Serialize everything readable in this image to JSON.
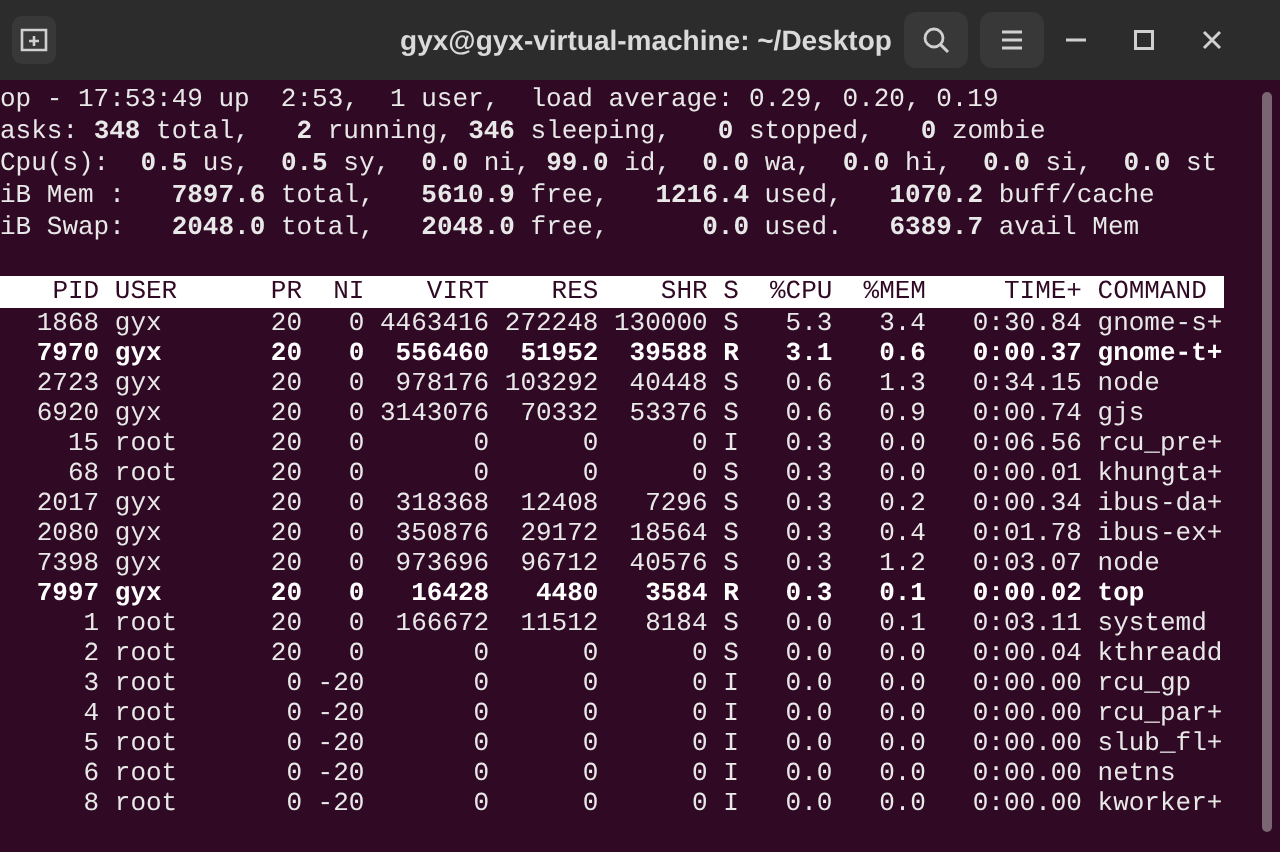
{
  "window": {
    "title": "gyx@gyx-virtual-machine: ~/Desktop"
  },
  "summary_lines": [
    "op - 17:53:49 up  2:53,  1 user,  load average: 0.29, 0.20, 0.19",
    "asks: **348** total,   **2** running, **346** sleeping,   **0** stopped,   **0** zombie",
    "Cpu(s):  **0.5** us,  **0.5** sy,  **0.0** ni, **99.0** id,  **0.0** wa,  **0.0** hi,  **0.0** si,  **0.0** st",
    "iB Mem :   **7897.6** total,   **5610.9** free,   **1216.4** used,   **1070.2** buff/cache",
    "iB Swap:   **2048.0** total,   **2048.0** free,      **0.0** used.   **6389.7** avail Mem"
  ],
  "table": {
    "columns": [
      "PID",
      "USER",
      "PR",
      "NI",
      "VIRT",
      "RES",
      "SHR",
      "S",
      "%CPU",
      "%MEM",
      "TIME+",
      "COMMAND"
    ],
    "rows": [
      {
        "emphasized": false,
        "cells": [
          "1868",
          "gyx",
          "20",
          "0",
          "4463416",
          "272248",
          "130000",
          "S",
          "5.3",
          "3.4",
          "0:30.84",
          "gnome-s+"
        ]
      },
      {
        "emphasized": true,
        "cells": [
          "7970",
          "gyx",
          "20",
          "0",
          "556460",
          "51952",
          "39588",
          "R",
          "3.1",
          "0.6",
          "0:00.37",
          "gnome-t+"
        ]
      },
      {
        "emphasized": false,
        "cells": [
          "2723",
          "gyx",
          "20",
          "0",
          "978176",
          "103292",
          "40448",
          "S",
          "0.6",
          "1.3",
          "0:34.15",
          "node"
        ]
      },
      {
        "emphasized": false,
        "cells": [
          "6920",
          "gyx",
          "20",
          "0",
          "3143076",
          "70332",
          "53376",
          "S",
          "0.6",
          "0.9",
          "0:00.74",
          "gjs"
        ]
      },
      {
        "emphasized": false,
        "cells": [
          "15",
          "root",
          "20",
          "0",
          "0",
          "0",
          "0",
          "I",
          "0.3",
          "0.0",
          "0:06.56",
          "rcu_pre+"
        ]
      },
      {
        "emphasized": false,
        "cells": [
          "68",
          "root",
          "20",
          "0",
          "0",
          "0",
          "0",
          "S",
          "0.3",
          "0.0",
          "0:00.01",
          "khungta+"
        ]
      },
      {
        "emphasized": false,
        "cells": [
          "2017",
          "gyx",
          "20",
          "0",
          "318368",
          "12408",
          "7296",
          "S",
          "0.3",
          "0.2",
          "0:00.34",
          "ibus-da+"
        ]
      },
      {
        "emphasized": false,
        "cells": [
          "2080",
          "gyx",
          "20",
          "0",
          "350876",
          "29172",
          "18564",
          "S",
          "0.3",
          "0.4",
          "0:01.78",
          "ibus-ex+"
        ]
      },
      {
        "emphasized": false,
        "cells": [
          "7398",
          "gyx",
          "20",
          "0",
          "973696",
          "96712",
          "40576",
          "S",
          "0.3",
          "1.2",
          "0:03.07",
          "node"
        ]
      },
      {
        "emphasized": true,
        "cells": [
          "7997",
          "gyx",
          "20",
          "0",
          "16428",
          "4480",
          "3584",
          "R",
          "0.3",
          "0.1",
          "0:00.02",
          "top"
        ]
      },
      {
        "emphasized": false,
        "cells": [
          "1",
          "root",
          "20",
          "0",
          "166672",
          "11512",
          "8184",
          "S",
          "0.0",
          "0.1",
          "0:03.11",
          "systemd"
        ]
      },
      {
        "emphasized": false,
        "cells": [
          "2",
          "root",
          "20",
          "0",
          "0",
          "0",
          "0",
          "S",
          "0.0",
          "0.0",
          "0:00.04",
          "kthreadd"
        ]
      },
      {
        "emphasized": false,
        "cells": [
          "3",
          "root",
          "0",
          "-20",
          "0",
          "0",
          "0",
          "I",
          "0.0",
          "0.0",
          "0:00.00",
          "rcu_gp"
        ]
      },
      {
        "emphasized": false,
        "cells": [
          "4",
          "root",
          "0",
          "-20",
          "0",
          "0",
          "0",
          "I",
          "0.0",
          "0.0",
          "0:00.00",
          "rcu_par+"
        ]
      },
      {
        "emphasized": false,
        "cells": [
          "5",
          "root",
          "0",
          "-20",
          "0",
          "0",
          "0",
          "I",
          "0.0",
          "0.0",
          "0:00.00",
          "slub_fl+"
        ]
      },
      {
        "emphasized": false,
        "cells": [
          "6",
          "root",
          "0",
          "-20",
          "0",
          "0",
          "0",
          "I",
          "0.0",
          "0.0",
          "0:00.00",
          "netns"
        ]
      },
      {
        "emphasized": false,
        "cells": [
          "8",
          "root",
          "0",
          "-20",
          "0",
          "0",
          "0",
          "I",
          "0.0",
          "0.0",
          "0:00.00",
          "kworker+"
        ]
      }
    ]
  }
}
